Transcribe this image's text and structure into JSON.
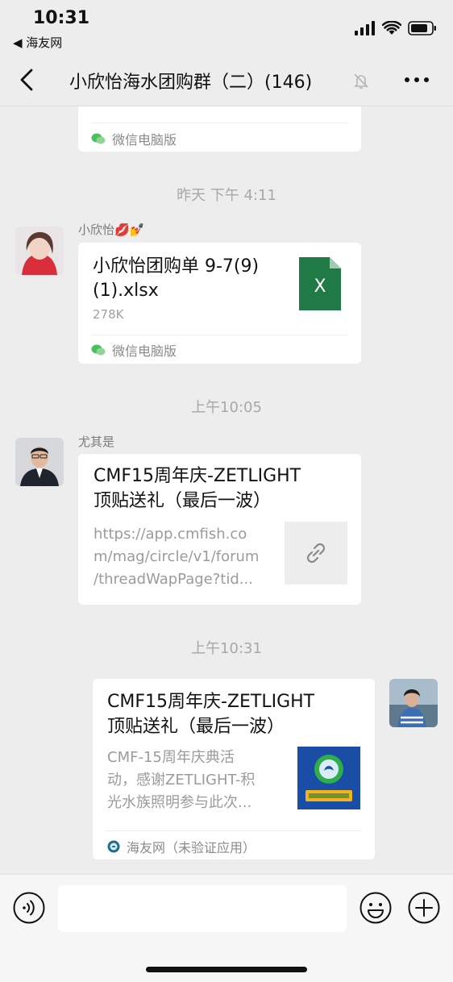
{
  "status_bar": {
    "time": "10:31",
    "back_app": "◀ 海友网",
    "icons": [
      "signal-icon",
      "wifi-icon",
      "battery-icon"
    ]
  },
  "nav": {
    "title": "小欣怡海水团购群（二）(146)",
    "icons": [
      "chevron-left-icon",
      "mute-bell-icon",
      "more-icon"
    ]
  },
  "messages": [
    {
      "type": "partial-card",
      "footer": "微信电脑版"
    },
    {
      "type": "timestamp",
      "text": "昨天 下午 4:11"
    },
    {
      "type": "file",
      "sender": "小欣怡💋💅",
      "title": "小欣怡团购单 9-7(9)(1).xlsx",
      "title_line1": "小欣怡团购单 9-7(9)",
      "title_line2": "(1).xlsx",
      "size": "278K",
      "file_icon_letter": "X",
      "footer": "微信电脑版"
    },
    {
      "type": "timestamp",
      "text": "上午10:05"
    },
    {
      "type": "link",
      "sender": "尤其是",
      "title_line1": "CMF15周年庆-ZETLIGHT",
      "title_line2": "顶贴送礼（最后一波）",
      "desc_line1": "https://app.cmfish.co",
      "desc_line2": "m/mag/circle/v1/forum",
      "desc_line3": "/threadWapPage?tid..."
    },
    {
      "type": "timestamp",
      "text": "上午10:31"
    },
    {
      "type": "app-link",
      "sender": "",
      "title_line1": "CMF15周年庆-ZETLIGHT",
      "title_line2": "顶贴送礼（最后一波）",
      "desc_line1": "CMF-15周年庆典活",
      "desc_line2": "动，感谢ZETLIGHT-积",
      "desc_line3": "光水族照明参与此次...",
      "footer": "海友网（未验证应用）"
    }
  ],
  "input_bar": {
    "placeholder": "",
    "icons": [
      "voice-icon",
      "emoji-icon",
      "plus-icon"
    ]
  },
  "colors": {
    "background": "#ededed",
    "bubble": "#ffffff",
    "excel_green": "#1f7a45",
    "wechat_green": "#07c160"
  }
}
